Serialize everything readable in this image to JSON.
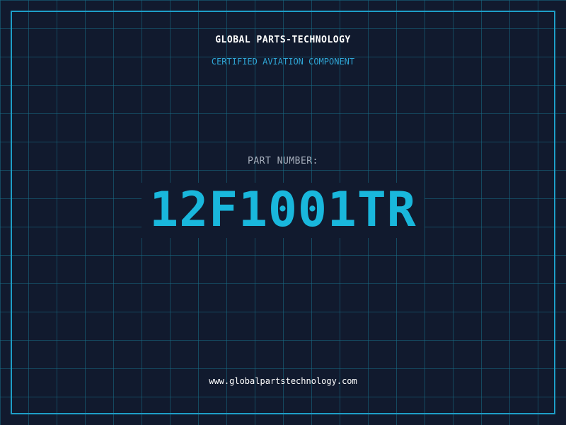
{
  "header": {
    "company_name": "GLOBAL PARTS-TECHNOLOGY",
    "tagline": "CERTIFIED AVIATION COMPONENT"
  },
  "part": {
    "label": "PART NUMBER:",
    "number": "12F1001TR"
  },
  "footer": {
    "url": "www.globalpartstechnology.com"
  },
  "colors": {
    "background": "#111a2e",
    "grid": "#176e87",
    "frame": "#1e9ec7",
    "accent": "#19b7dc"
  }
}
